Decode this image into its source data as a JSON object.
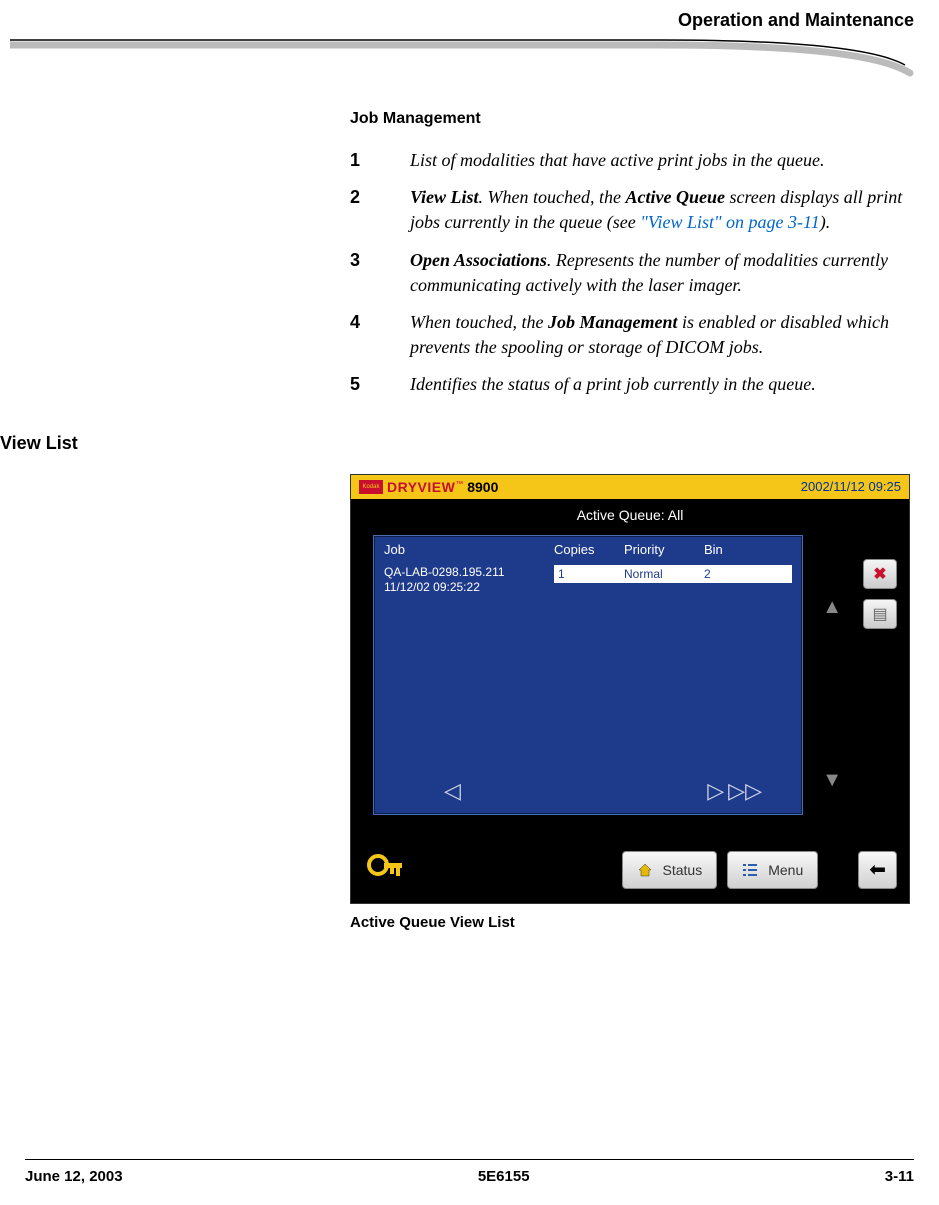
{
  "header": {
    "title": "Operation and Maintenance"
  },
  "section": {
    "heading": "Job Management"
  },
  "list": {
    "items": [
      {
        "num": "1",
        "text_a": "List of modalities that have active print jobs in the queue."
      },
      {
        "num": "2",
        "bold_lead": "View List",
        "text_b": ". When touched, the ",
        "bold_mid": "Active Queue",
        "text_c": " screen displays all print jobs currently in the queue (see ",
        "link": "\"View List\" on page 3-11",
        "text_d": ")."
      },
      {
        "num": "3",
        "bold_lead": "Open Associations",
        "text_b": ". Represents the number of modalities currently communicating actively with the laser imager."
      },
      {
        "num": "4",
        "text_a": "When touched, the ",
        "bold_mid": "Job Management",
        "text_c": " is enabled or disabled which prevents the spooling or storage of DICOM jobs."
      },
      {
        "num": "5",
        "text_a": "Identifies the status of a print job currently in the queue."
      }
    ]
  },
  "side_heading": "View List",
  "device": {
    "brand_chip": "Kodak",
    "brand_dry": "DRYVIEW",
    "brand_tm": "™",
    "brand_model": "8900",
    "clock": "2002/11/12 09:25",
    "queue_title": "Active Queue: All",
    "columns": {
      "job": "Job",
      "copies": "Copies",
      "priority": "Priority",
      "bin": "Bin"
    },
    "row": {
      "job_line1": "QA-LAB-0298.195.211",
      "job_line2": "11/12/02 09:25:22",
      "copies": "1",
      "priority": "Normal",
      "bin": "2"
    },
    "buttons": {
      "status": "Status",
      "menu": "Menu"
    }
  },
  "figure_caption": "Active Queue View List",
  "footer": {
    "date": "June 12, 2003",
    "docnum": "5E6155",
    "page": "3-11"
  }
}
